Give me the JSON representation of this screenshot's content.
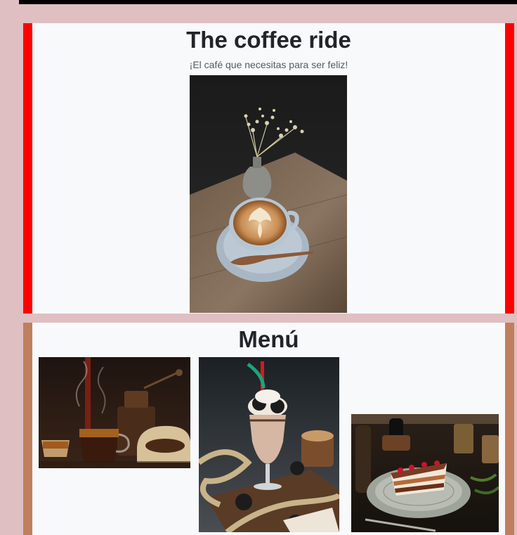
{
  "hero": {
    "title": "The coffee ride",
    "subtitle": "¡El café que necesitas para ser feliz!",
    "photo_icon": "latte-art-cup-photo",
    "accent_color": "#ff0000"
  },
  "menu": {
    "title": "Menú",
    "accent_color": "#bf7f5f",
    "items": [
      {
        "photo_icon": "coffee-pour-beans-photo"
      },
      {
        "photo_icon": "cookie-milkshake-photo"
      },
      {
        "photo_icon": "cake-slice-plate-photo"
      }
    ]
  },
  "colors": {
    "page_background": "#dfbfc1",
    "card_background": "#f8f9fb",
    "top_bar": "#000000"
  }
}
